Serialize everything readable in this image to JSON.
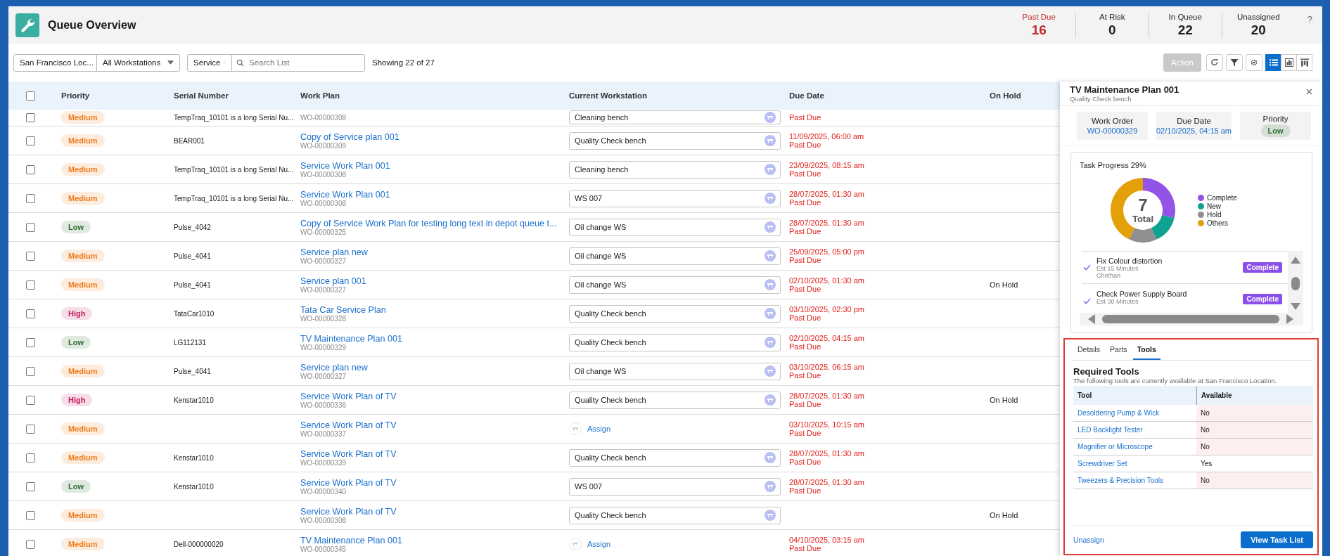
{
  "header": {
    "title": "Queue Overview",
    "help": "?",
    "stats": [
      {
        "label": "Past Due",
        "value": "16",
        "alert": true
      },
      {
        "label": "At Risk",
        "value": "0",
        "alert": false
      },
      {
        "label": "In Queue",
        "value": "22",
        "alert": false
      },
      {
        "label": "Unassigned",
        "value": "20",
        "alert": false
      }
    ]
  },
  "toolbar": {
    "location": "San Francisco Loc...",
    "workstation": "All Workstations",
    "type": "Service",
    "search": {
      "placeholder": "Search List"
    },
    "count": "Showing 22 of 27",
    "action": {
      "label": "Action",
      "disabled": true
    },
    "tools": [
      {
        "kind": "refresh"
      },
      {
        "kind": "filter"
      },
      {
        "kind": "settings"
      }
    ],
    "views": [
      {
        "kind": "list",
        "selected": true
      },
      {
        "kind": "chart",
        "selected": false
      },
      {
        "kind": "columns",
        "selected": false
      }
    ]
  },
  "table": {
    "select_all": {
      "checked": false
    },
    "columns": [
      "Priority",
      "Serial Number",
      "Work Plan",
      "Current Workstation",
      "Due Date",
      "On Hold"
    ],
    "rows": [
      {
        "checked": false,
        "priority": "Medium",
        "color": "#ee7d1e",
        "serial": "TempTraq_10101 is a long Serial Nu...",
        "work_order": "WO-00000308",
        "workstation": {
          "kind": "field",
          "value": "Cleaning bench"
        },
        "due_status": "Past Due"
      },
      {
        "checked": false,
        "priority": "Medium",
        "color": "#ee7d1e",
        "serial": "BEAR001",
        "plan": "Copy of Service plan 001",
        "work_order": "WO-00000309",
        "workstation": {
          "kind": "field",
          "value": "Quality Check bench"
        },
        "due": "11/09/2025, 06:00 am",
        "due_status": "Past Due"
      },
      {
        "checked": false,
        "priority": "Medium",
        "color": "#ee7d1e",
        "serial": "TempTraq_10101 is a long Serial Nu...",
        "plan": "Service Work Plan 001",
        "work_order": "WO-00000308",
        "workstation": {
          "kind": "field",
          "value": "Cleaning bench"
        },
        "due": "23/09/2025, 08:15 am",
        "due_status": "Past Due"
      },
      {
        "checked": false,
        "priority": "Medium",
        "color": "#ee7d1e",
        "serial": "TempTraq_10101 is a long Serial Nu...",
        "plan": "Service Work Plan 001",
        "work_order": "WO-00000308",
        "workstation": {
          "kind": "field",
          "value": "WS 007"
        },
        "due": "28/07/2025, 01:30 am",
        "due_status": "Past Due"
      },
      {
        "checked": false,
        "priority": "Low",
        "color": "#2f6e2e",
        "serial": "Pulse_4042",
        "plan": "Copy of Service Work Plan for testing long text in depot queue t...",
        "work_order": "WO-00000325",
        "workstation": {
          "kind": "field",
          "value": "Oil change WS"
        },
        "due": "28/07/2025, 01:30 am",
        "due_status": "Past Due"
      },
      {
        "checked": false,
        "priority": "Medium",
        "color": "#ee7d1e",
        "serial": "Pulse_4041",
        "plan": "Service plan new",
        "work_order": "WO-00000327",
        "workstation": {
          "kind": "field",
          "value": "Oil change WS"
        },
        "due": "25/09/2025, 05:00 pm",
        "due_status": "Past Due"
      },
      {
        "checked": false,
        "priority": "Medium",
        "color": "#ee7d1e",
        "serial": "Pulse_4041",
        "plan": "Service plan 001",
        "work_order": "WO-00000327",
        "workstation": {
          "kind": "field",
          "value": "Oil change WS"
        },
        "due": "02/10/2025, 01:30 am",
        "due_status": "Past Due",
        "on_hold": "On Hold"
      },
      {
        "checked": false,
        "priority": "High",
        "color": "#c2185b",
        "serial": "TataCar1010",
        "plan": "Tata Car Service Plan",
        "work_order": "WO-00000328",
        "workstation": {
          "kind": "field",
          "value": "Quality Check bench"
        },
        "due": "03/10/2025, 02:30 pm",
        "due_status": "Past Due"
      },
      {
        "checked": false,
        "priority": "Low",
        "color": "#2f6e2e",
        "serial": "LG112131",
        "plan": "TV Maintenance Plan 001",
        "work_order": "WO-00000329",
        "workstation": {
          "kind": "field",
          "value": "Quality Check bench"
        },
        "due": "02/10/2025, 04:15 am",
        "due_status": "Past Due"
      },
      {
        "checked": false,
        "priority": "Medium",
        "color": "#ee7d1e",
        "serial": "Pulse_4041",
        "plan": "Service plan new",
        "work_order": "WO-00000327",
        "workstation": {
          "kind": "field",
          "value": "Oil change WS"
        },
        "due": "03/10/2025, 06:15 am",
        "due_status": "Past Due"
      },
      {
        "checked": false,
        "priority": "High",
        "color": "#c2185b",
        "serial": "Kenstar1010",
        "plan": "Service Work Plan of TV",
        "work_order": "WO-00000336",
        "workstation": {
          "kind": "field",
          "value": "Quality Check bench"
        },
        "due": "28/07/2025, 01:30 am",
        "due_status": "Past Due",
        "on_hold": "On Hold"
      },
      {
        "checked": false,
        "priority": "Medium",
        "color": "#ee7d1e",
        "plan": "Service Work Plan of TV",
        "work_order": "WO-00000337",
        "workstation": {
          "kind": "assign",
          "value": "Assign"
        },
        "due": "03/10/2025, 10:15 am",
        "due_status": "Past Due"
      },
      {
        "checked": false,
        "priority": "Medium",
        "color": "#ee7d1e",
        "serial": "Kenstar1010",
        "plan": "Service Work Plan of TV",
        "work_order": "WO-00000339",
        "workstation": {
          "kind": "field",
          "value": "Quality Check bench"
        },
        "due": "28/07/2025, 01:30 am",
        "due_status": "Past Due"
      },
      {
        "checked": false,
        "priority": "Low",
        "color": "#2f6e2e",
        "serial": "Kenstar1010",
        "plan": "Service Work Plan of TV",
        "work_order": "WO-00000340",
        "workstation": {
          "kind": "field",
          "value": "WS 007"
        },
        "due": "28/07/2025, 01:30 am",
        "due_status": "Past Due"
      },
      {
        "checked": false,
        "priority": "Medium",
        "color": "#ee7d1e",
        "plan": "Service Work Plan of TV",
        "work_order": "WO-00000308",
        "workstation": {
          "kind": "field",
          "value": "Quality Check bench"
        },
        "on_hold": "On Hold"
      },
      {
        "checked": false,
        "priority": "Medium",
        "color": "#ee7d1e",
        "serial": "Dell-000000020",
        "plan": "TV Maintenance Plan 001",
        "work_order": "WO-00000345",
        "workstation": {
          "kind": "assign",
          "value": "Assign"
        },
        "due": "04/10/2025, 03:15 am",
        "due_status": "Past Due"
      }
    ]
  },
  "panel": {
    "title": "TV Maintenance Plan 001",
    "subtitle": "Quality Check bench",
    "summary": [
      {
        "label": "Work Order",
        "value": "WO-00000329",
        "kind": "link"
      },
      {
        "label": "Due Date",
        "value": "02/10/2025, 04:15 am",
        "kind": "link"
      },
      {
        "label": "Priority",
        "value": "Low",
        "kind": "badge",
        "color": "#2f6e2e"
      }
    ],
    "progress": {
      "title": "Task Progress 29%",
      "center_value": "7",
      "center_label": "Total",
      "chart_data": {
        "type": "donut",
        "legend": "right",
        "categories": [
          "Complete",
          "New",
          "Hold",
          "Others"
        ],
        "colors": [
          "#9153e8",
          "#0ea292",
          "#8f8f8f",
          "#e3a008"
        ],
        "values": [
          29,
          14,
          14,
          43
        ]
      },
      "tasks": [
        {
          "name": "Fix Colour distortion",
          "estimate": "Est 15 Minutes",
          "assignee": "Chethan",
          "status": "Complete",
          "done": true
        },
        {
          "name": "Check Power Supply Board",
          "estimate": "Est 30 Minutes",
          "status": "Complete",
          "done": true
        }
      ]
    },
    "tabs": [
      {
        "label": "Details",
        "selected": false
      },
      {
        "label": "Parts",
        "selected": false
      },
      {
        "label": "Tools",
        "selected": true
      }
    ],
    "tools": {
      "heading": "Required Tools",
      "description": "The following tools are currently available at San Francisco Location.",
      "columns": [
        "Tool",
        "Available"
      ],
      "rows": [
        {
          "tool": "Desoldering Pump & Wick",
          "available": "No",
          "missing": true
        },
        {
          "tool": "LED Backlight Tester",
          "available": "No",
          "missing": true
        },
        {
          "tool": "Magnifier or Microscope",
          "available": "No",
          "missing": true
        },
        {
          "tool": "Screwdriver Set",
          "available": "Yes",
          "missing": false
        },
        {
          "tool": "Tweezers & Precision Tools",
          "available": "No",
          "missing": true
        }
      ]
    },
    "footer": {
      "unassign": "Unassign",
      "primary": "View Task List"
    }
  }
}
